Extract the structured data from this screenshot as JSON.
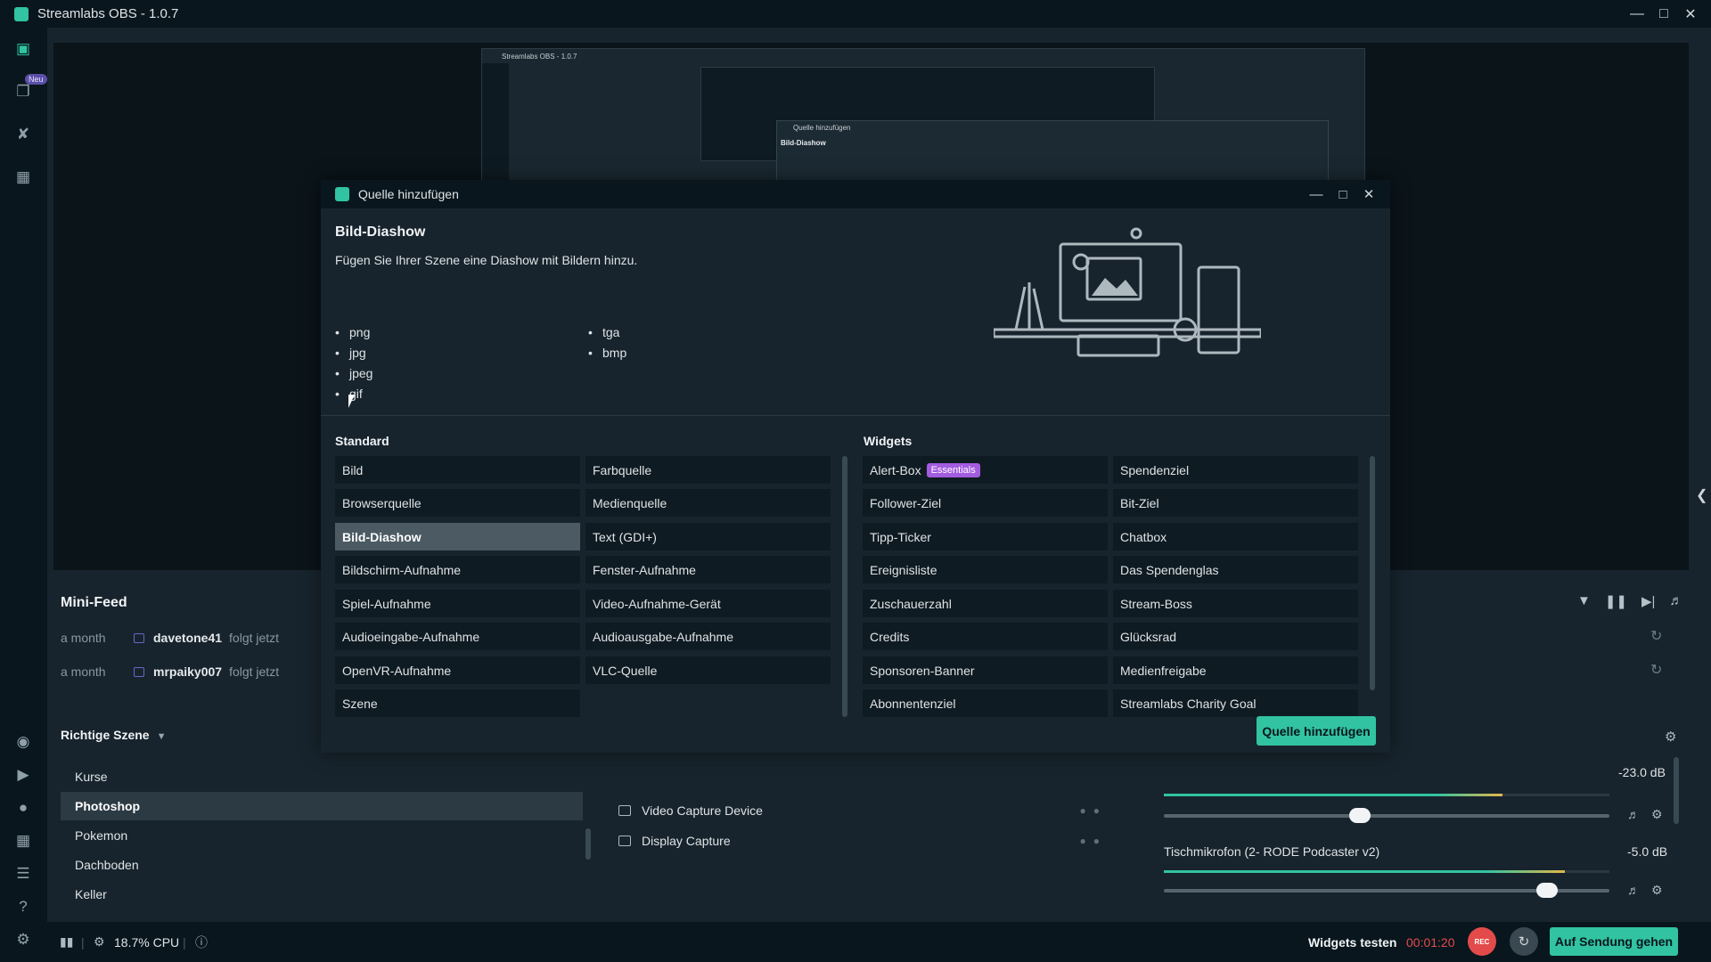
{
  "window": {
    "title": "Streamlabs OBS - 1.0.7"
  },
  "nav": {
    "neu_badge": "Neu"
  },
  "preview": {
    "nested_title": "Streamlabs OBS - 1.0.7",
    "nested_dialog_title": "Quelle hinzufügen",
    "nested_dialog_heading": "Bild-Diashow"
  },
  "minifeed": {
    "title": "Mini-Feed",
    "items": [
      {
        "time": "a month",
        "user": "davetone41",
        "action": "folgt jetzt"
      },
      {
        "time": "a month",
        "user": "mrpaiky007",
        "action": "folgt jetzt"
      }
    ]
  },
  "scenes": {
    "current": "Richtige Szene",
    "items": [
      "Kurse",
      "Photoshop",
      "Pokemon",
      "Dachboden",
      "Keller"
    ],
    "selected": "Photoshop"
  },
  "sources": {
    "items": [
      "Video Capture Device",
      "Display Capture"
    ]
  },
  "mixer": {
    "track1": {
      "db": "-23.0 dB",
      "level": 0.76,
      "volume": 0.44
    },
    "track2": {
      "name": "Tischmikrofon (2- RODE Podcaster v2)",
      "db": "-5.0 dB",
      "level": 0.9,
      "volume": 0.86
    }
  },
  "footer": {
    "cpu": "18.7% CPU",
    "test_widgets": "Widgets testen",
    "timer": "00:01:20",
    "rec": "REC",
    "go_live": "Auf Sendung gehen"
  },
  "dialog": {
    "title": "Quelle hinzufügen",
    "source_title": "Bild-Diashow",
    "source_desc": "Fügen Sie Ihrer Szene eine Diashow mit Bildern hinzu.",
    "formats_col1": [
      "png",
      "jpg",
      "jpeg",
      "gif"
    ],
    "formats_col2": [
      "tga",
      "bmp"
    ],
    "standard_header": "Standard",
    "widgets_header": "Widgets",
    "standard_col1": [
      "Bild",
      "Browserquelle",
      "Bild-Diashow",
      "Bildschirm-Aufnahme",
      "Spiel-Aufnahme",
      "Audioeingabe-Aufnahme",
      "OpenVR-Aufnahme",
      "Szene"
    ],
    "standard_col2": [
      "Farbquelle",
      "Medienquelle",
      "Text (GDI+)",
      "Fenster-Aufnahme",
      "Video-Aufnahme-Gerät",
      "Audioausgabe-Aufnahme",
      "VLC-Quelle"
    ],
    "widgets_col1": [
      "Alert-Box",
      "Follower-Ziel",
      "Tipp-Ticker",
      "Ereignisliste",
      "Zuschauerzahl",
      "Credits",
      "Sponsoren-Banner",
      "Abonnentenziel"
    ],
    "widgets_col2": [
      "Spendenziel",
      "Bit-Ziel",
      "Chatbox",
      "Das Spendenglas",
      "Stream-Boss",
      "Glücksrad",
      "Medienfreigabe",
      "Streamlabs Charity Goal"
    ],
    "essentials_badge": "Essentials",
    "add_button": "Quelle hinzufügen"
  },
  "colors": {
    "accent": "#31c3a2",
    "rec": "#e34b4b",
    "badge": "#a35ce0",
    "bg": "#17242d",
    "dark": "#09161d"
  }
}
